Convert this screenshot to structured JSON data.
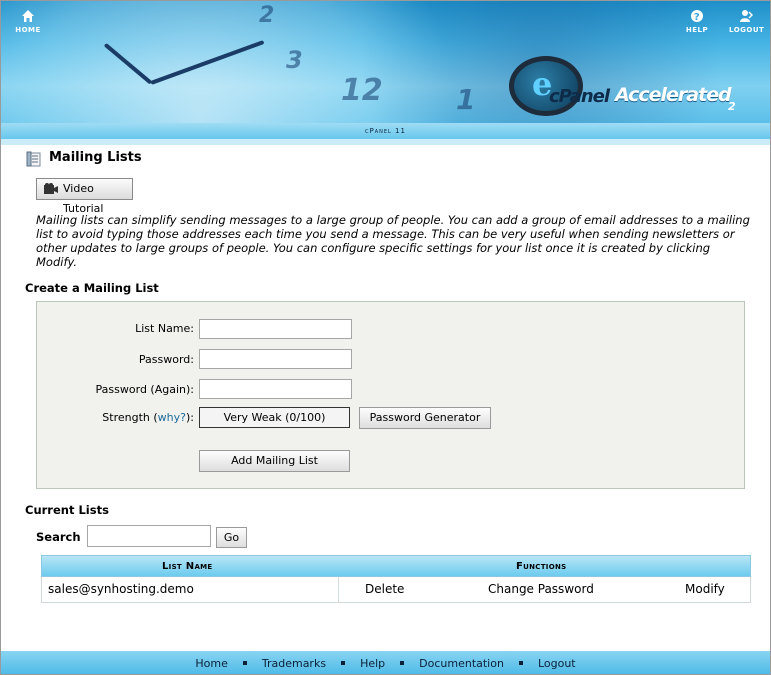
{
  "topnav": {
    "home_label": "HOME",
    "help_label": "HELP",
    "logout_label": "LOGOUT"
  },
  "logo": {
    "brand": "cPanel",
    "product": "Accelerated",
    "version": "2"
  },
  "header_clock_numbers": [
    "2",
    "3",
    "12",
    "1"
  ],
  "subbar": {
    "version_text": "cPanel 11"
  },
  "page": {
    "title": "Mailing Lists",
    "video_button_label": "Video Tutorial",
    "description": "Mailing lists can simplify sending messages to a large group of people. You can add a group of email addresses to a mailing list to avoid typing those addresses each time you send a message. This can be very useful when sending newsletters or other updates to large groups of people. You can configure specific settings for your list once it is created by clicking Modify."
  },
  "create": {
    "heading": "Create a Mailing List",
    "list_name_label": "List Name:",
    "list_name_value": "",
    "password_label": "Password:",
    "password_value": "",
    "password_again_label": "Password (Again):",
    "password_again_value": "",
    "strength_label_prefix": "Strength (",
    "strength_why_link": "why?",
    "strength_label_suffix": "):",
    "strength_value": "Very Weak (0/100)",
    "password_generator_label": "Password Generator",
    "add_button_label": "Add Mailing List"
  },
  "current": {
    "heading": "Current Lists",
    "search_label": "Search",
    "search_value": "",
    "go_label": "Go",
    "columns": {
      "list_name": "List Name",
      "functions": "Functions"
    },
    "rows": [
      {
        "list_name": "sales@synhosting.demo",
        "delete": "Delete",
        "change_password": "Change Password",
        "modify": "Modify"
      }
    ]
  },
  "footer": {
    "links": [
      "Home",
      "Trademarks",
      "Help",
      "Documentation",
      "Logout"
    ]
  },
  "colors": {
    "header_blue": "#46b4e4",
    "table_header": "#6ccbee",
    "link": "#1a6b9c"
  }
}
